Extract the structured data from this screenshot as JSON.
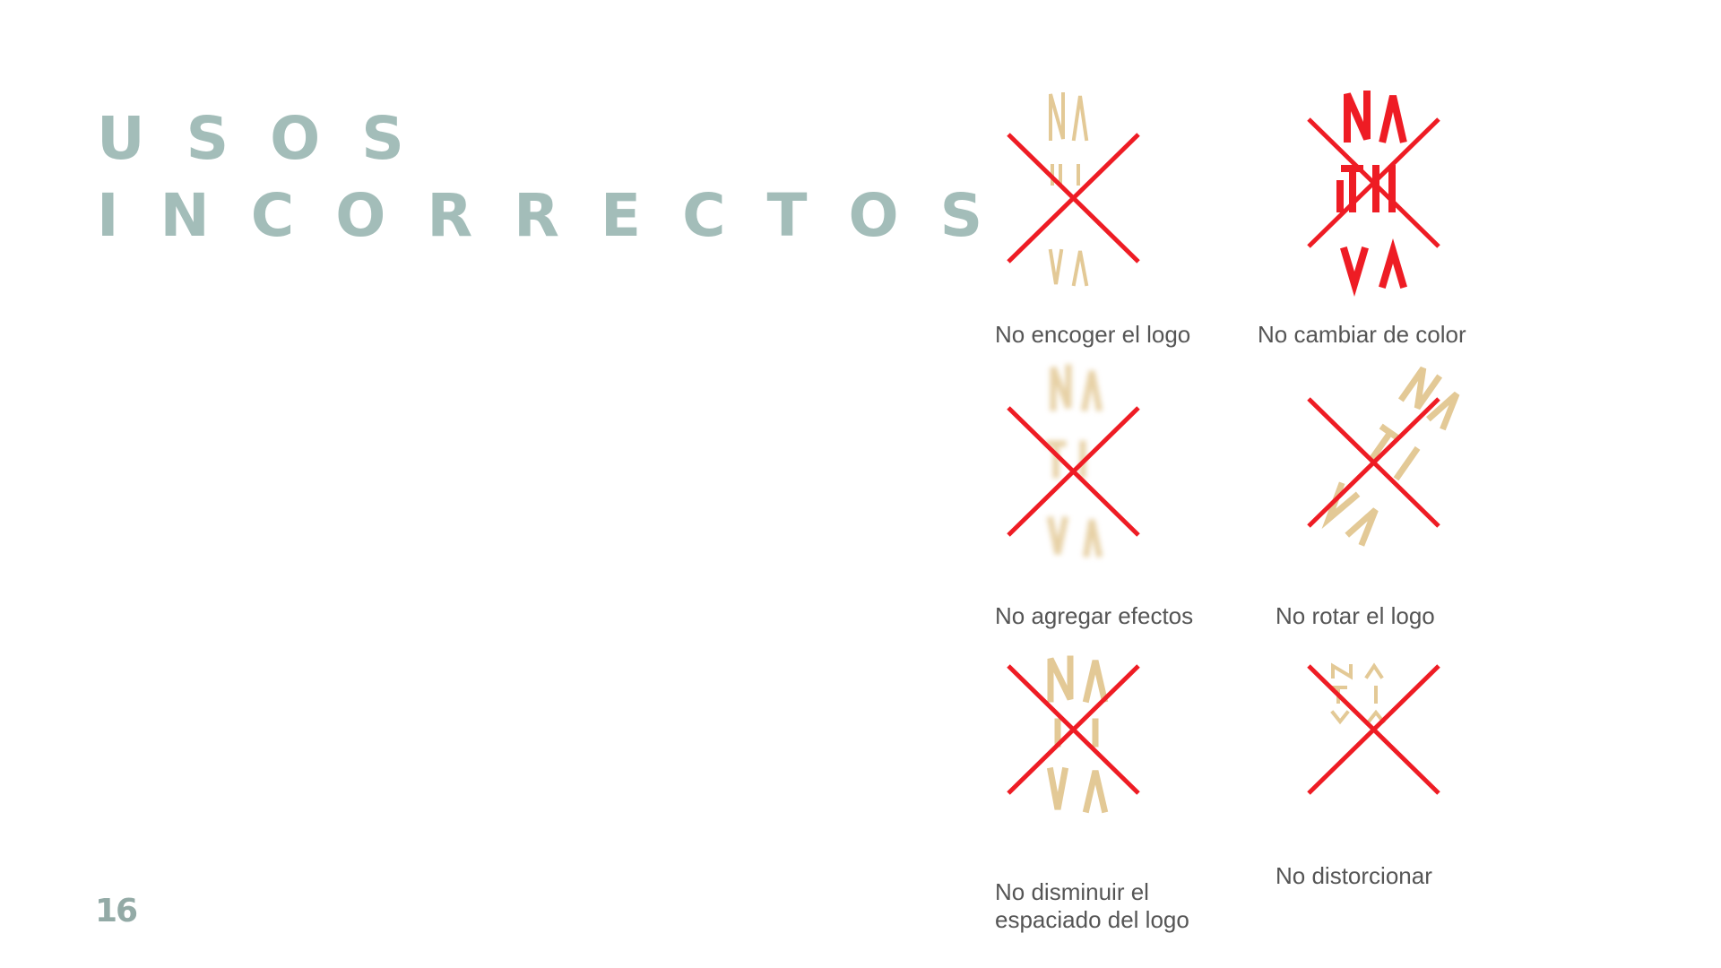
{
  "slide": {
    "title_line1": "USOS",
    "title_line2": "INCORRECTOS",
    "page_number": "16"
  },
  "logo": {
    "letters_row1": [
      "N",
      "A"
    ],
    "letters_row2": [
      "T",
      "I"
    ],
    "letters_row3": [
      "V",
      "A"
    ]
  },
  "colors": {
    "title": "#a3bdb9",
    "logo_gold": "#e3c996",
    "logo_red": "#ee1c24",
    "cross_red": "#ee1c24",
    "caption": "#555555"
  },
  "examples": [
    {
      "caption": "No encoger el logo",
      "icon": "logo-shrunk-crossed-icon"
    },
    {
      "caption": "No cambiar de color",
      "icon": "logo-recolored-crossed-icon"
    },
    {
      "caption": "No agregar efectos",
      "icon": "logo-blurred-crossed-icon"
    },
    {
      "caption": "No rotar el logo",
      "icon": "logo-rotated-crossed-icon"
    },
    {
      "caption_line1": "No disminuir el",
      "caption_line2": "espaciado del logo",
      "icon": "logo-tight-spacing-crossed-icon"
    },
    {
      "caption": "No distorcionar",
      "icon": "logo-distorted-crossed-icon"
    }
  ]
}
